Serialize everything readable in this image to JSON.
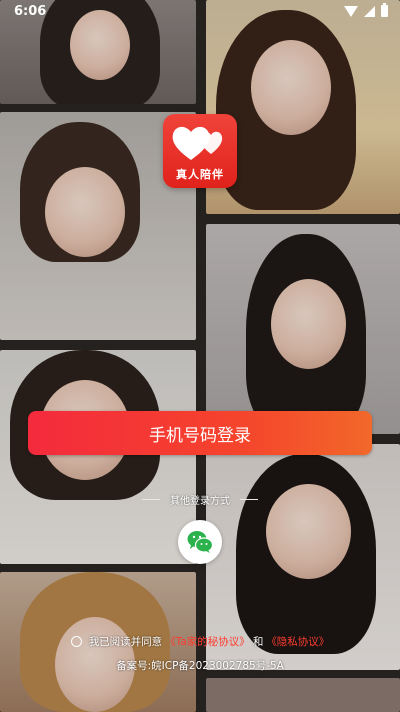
{
  "status_bar": {
    "time": "6:06"
  },
  "app": {
    "name": "真人陪伴",
    "brand_color": "#e8312a"
  },
  "login": {
    "phone_button_label": "手机号码登录"
  },
  "other_login": {
    "label": "其他登录方式",
    "wechat_icon": "wechat-icon"
  },
  "agreement": {
    "prefix": "我已阅读并同意",
    "user_agreement": "《Ta家的秘协议》",
    "conjunction": "和",
    "privacy_policy": "《隐私协议》"
  },
  "icp": {
    "text": "备案号:皖ICP备2023002785号-5A"
  }
}
